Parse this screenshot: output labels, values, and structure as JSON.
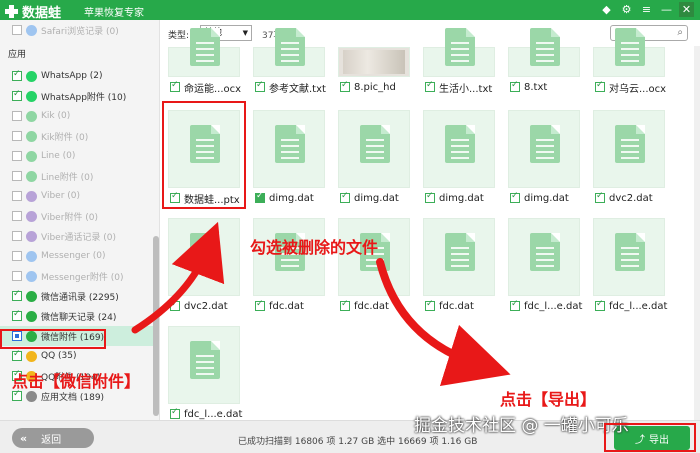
{
  "titlebar": {
    "logo_text": "数据蛙",
    "subtitle": "苹果恢复专家",
    "controls": [
      "diamond-icon",
      "settings-icon",
      "menu-icon",
      "minimize-icon",
      "close-icon"
    ]
  },
  "sidebar": {
    "top_item": "Safari浏览记录 (0)",
    "section": "应用",
    "items": [
      {
        "label": "WhatsApp (2)",
        "checked": true,
        "enabled": true,
        "icon": "whatsapp-icon",
        "color": "#25d366"
      },
      {
        "label": "WhatsApp附件 (10)",
        "checked": true,
        "enabled": true,
        "icon": "whatsapp-attachment-icon",
        "color": "#25d366"
      },
      {
        "label": "Kik (0)",
        "checked": false,
        "enabled": false,
        "icon": "kik-icon",
        "color": "#8fd6a3"
      },
      {
        "label": "Kik附件 (0)",
        "checked": false,
        "enabled": false,
        "icon": "kik-attachment-icon",
        "color": "#8fd6a3"
      },
      {
        "label": "Line (0)",
        "checked": false,
        "enabled": false,
        "icon": "line-icon",
        "color": "#8fd6a3"
      },
      {
        "label": "Line附件 (0)",
        "checked": false,
        "enabled": false,
        "icon": "line-attachment-icon",
        "color": "#8fd6a3"
      },
      {
        "label": "Viber (0)",
        "checked": false,
        "enabled": false,
        "icon": "viber-icon",
        "color": "#b8a3d8"
      },
      {
        "label": "Viber附件 (0)",
        "checked": false,
        "enabled": false,
        "icon": "viber-attachment-icon",
        "color": "#b8a3d8"
      },
      {
        "label": "Viber通话记录 (0)",
        "checked": false,
        "enabled": false,
        "icon": "viber-calls-icon",
        "color": "#b8a3d8"
      },
      {
        "label": "Messenger (0)",
        "checked": false,
        "enabled": false,
        "icon": "messenger-icon",
        "color": "#9fc5f0"
      },
      {
        "label": "Messenger附件 (0)",
        "checked": false,
        "enabled": false,
        "icon": "messenger-attachment-icon",
        "color": "#9fc5f0"
      },
      {
        "label": "微信通讯录 (2295)",
        "checked": true,
        "enabled": true,
        "icon": "wechat-contacts-icon",
        "color": "#2aae45"
      },
      {
        "label": "微信聊天记录 (24)",
        "checked": true,
        "enabled": true,
        "icon": "wechat-chat-icon",
        "color": "#2aae45"
      },
      {
        "label": "微信附件 (169)",
        "checked": "partial",
        "enabled": true,
        "selected": true,
        "icon": "wechat-attachment-icon",
        "color": "#2aae45"
      },
      {
        "label": "QQ (35)",
        "checked": true,
        "enabled": true,
        "icon": "qq-icon",
        "color": "#f2b51c"
      },
      {
        "label": "QQ附件 (194)",
        "checked": true,
        "enabled": true,
        "icon": "qq-attachment-icon",
        "color": "#f2b51c"
      },
      {
        "label": "应用文档 (189)",
        "checked": true,
        "enabled": true,
        "icon": "app-docs-icon",
        "color": "#8a8a8a"
      }
    ]
  },
  "toolbar": {
    "type_label": "类型:",
    "type_value": "其他",
    "item_count": "37项目",
    "search_placeholder": ""
  },
  "files": [
    {
      "name": "命运能...ocx",
      "kind": "partial"
    },
    {
      "name": "参考文献.txt",
      "kind": "partial"
    },
    {
      "name": "8.pic_hd",
      "kind": "photo"
    },
    {
      "name": "生活小...txt",
      "kind": "partial"
    },
    {
      "name": "8.txt",
      "kind": "partial"
    },
    {
      "name": "对乌云...ocx",
      "kind": "partial"
    },
    {
      "name": "数据蛙...ptx",
      "kind": "doc",
      "highlight": true
    },
    {
      "name": "dimg.dat",
      "kind": "doc",
      "green": true
    },
    {
      "name": "dimg.dat",
      "kind": "doc"
    },
    {
      "name": "dimg.dat",
      "kind": "doc"
    },
    {
      "name": "dimg.dat",
      "kind": "doc"
    },
    {
      "name": "dvc2.dat",
      "kind": "doc"
    },
    {
      "name": "dvc2.dat",
      "kind": "doc"
    },
    {
      "name": "fdc.dat",
      "kind": "doc"
    },
    {
      "name": "fdc.dat",
      "kind": "doc"
    },
    {
      "name": "fdc.dat",
      "kind": "doc"
    },
    {
      "name": "fdc_l...e.dat",
      "kind": "doc"
    },
    {
      "name": "fdc_l...e.dat",
      "kind": "doc"
    },
    {
      "name": "fdc_l...e.dat",
      "kind": "doc"
    }
  ],
  "bottombar": {
    "back_label": "返回",
    "status": "已成功扫描到 16806 项 1.27 GB  选中 16669 项 1.16 GB",
    "export_label": "导出"
  },
  "annotations": {
    "select_deleted": "勾选被删除的文件",
    "click_attachment": "点击【微信附件】",
    "click_export": "点击【导出】",
    "watermark": "掘金技术社区 @ 一罐小可乐",
    "color": "#e81818"
  }
}
